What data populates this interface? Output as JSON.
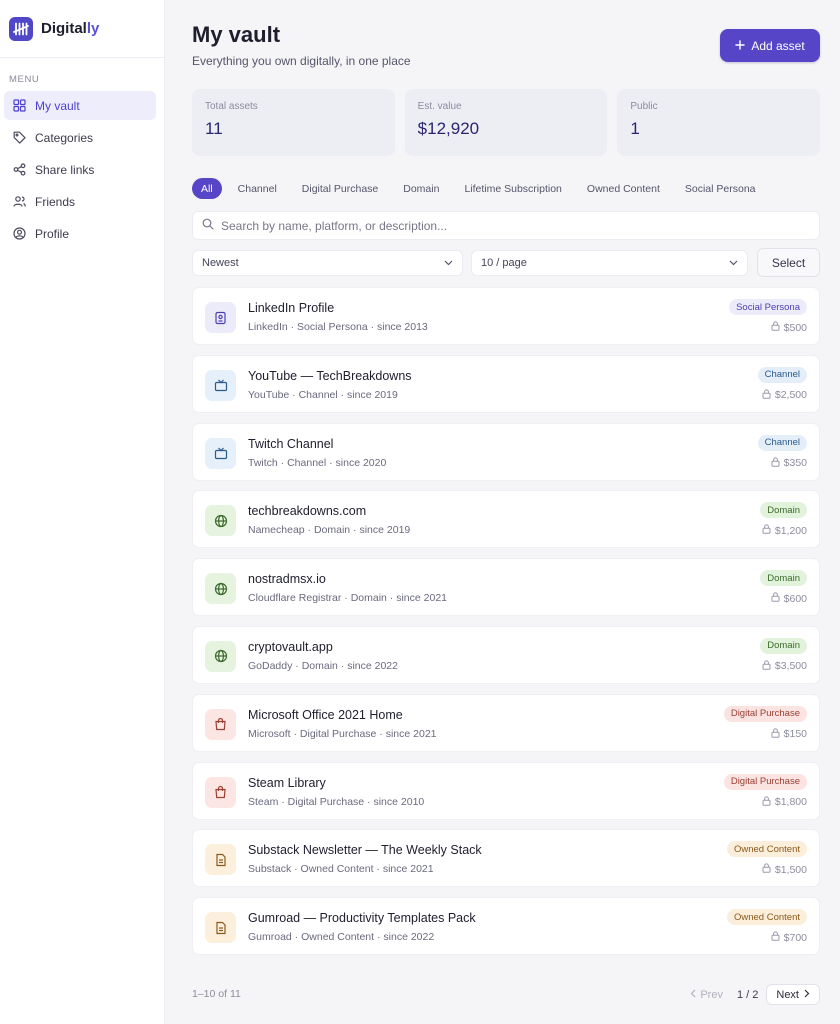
{
  "brand": {
    "name_main": "Digital",
    "name_accent": "ly"
  },
  "sidebar": {
    "menu_label": "MENU",
    "items": [
      {
        "label": "My vault",
        "icon": "grid-icon",
        "active": true
      },
      {
        "label": "Categories",
        "icon": "tag-icon"
      },
      {
        "label": "Share links",
        "icon": "share-icon"
      },
      {
        "label": "Friends",
        "icon": "users-icon"
      },
      {
        "label": "Profile",
        "icon": "user-circle-icon"
      }
    ]
  },
  "header": {
    "title": "My vault",
    "subtitle": "Everything you own digitally, in one place",
    "add_label": "Add asset"
  },
  "stats": [
    {
      "label": "Total assets",
      "value": "11"
    },
    {
      "label": "Est. value",
      "value": "$12,920"
    },
    {
      "label": "Public",
      "value": "1"
    }
  ],
  "filters": [
    "All",
    "Channel",
    "Digital Purchase",
    "Domain",
    "Lifetime Subscription",
    "Owned Content",
    "Social Persona"
  ],
  "search": {
    "placeholder": "Search by name, platform, or description..."
  },
  "controls": {
    "sort": "Newest",
    "per_page": "10 / page",
    "select_label": "Select"
  },
  "category_colors": {
    "Social Persona": {
      "bg": "#ecebfa",
      "fg": "#4b3fb0",
      "icon_bg": "#ecebfa"
    },
    "Channel": {
      "bg": "#e3eef9",
      "fg": "#2a5a8a",
      "icon_bg": "#e6f0fa"
    },
    "Domain": {
      "bg": "#e2f3dc",
      "fg": "#3b6a2c",
      "icon_bg": "#e5f3df"
    },
    "Digital Purchase": {
      "bg": "#fae3e0",
      "fg": "#9a4034",
      "icon_bg": "#fbe6e3"
    },
    "Owned Content": {
      "bg": "#fbeedb",
      "fg": "#8a5a1c",
      "icon_bg": "#fcefdc"
    }
  },
  "assets": [
    {
      "name": "LinkedIn Profile",
      "meta": "LinkedIn · Social Persona · since 2013",
      "category": "Social Persona",
      "price": "$500",
      "icon": "badge-id-icon"
    },
    {
      "name": "YouTube — TechBreakdowns",
      "meta": "YouTube · Channel · since 2019",
      "category": "Channel",
      "price": "$2,500",
      "icon": "tv-icon"
    },
    {
      "name": "Twitch Channel",
      "meta": "Twitch · Channel · since 2020",
      "category": "Channel",
      "price": "$350",
      "icon": "tv-icon"
    },
    {
      "name": "techbreakdowns.com",
      "meta": "Namecheap · Domain · since 2019",
      "category": "Domain",
      "price": "$1,200",
      "icon": "globe-icon"
    },
    {
      "name": "nostradmsx.io",
      "meta": "Cloudflare Registrar · Domain · since 2021",
      "category": "Domain",
      "price": "$600",
      "icon": "globe-icon"
    },
    {
      "name": "cryptovault.app",
      "meta": "GoDaddy · Domain · since 2022",
      "category": "Domain",
      "price": "$3,500",
      "icon": "globe-icon"
    },
    {
      "name": "Microsoft Office 2021 Home",
      "meta": "Microsoft · Digital Purchase · since 2021",
      "category": "Digital Purchase",
      "price": "$150",
      "icon": "shopping-bag-icon"
    },
    {
      "name": "Steam Library",
      "meta": "Steam · Digital Purchase · since 2010",
      "category": "Digital Purchase",
      "price": "$1,800",
      "icon": "shopping-bag-icon"
    },
    {
      "name": "Substack Newsletter — The Weekly Stack",
      "meta": "Substack · Owned Content · since 2021",
      "category": "Owned Content",
      "price": "$1,500",
      "icon": "document-icon"
    },
    {
      "name": "Gumroad — Productivity Templates Pack",
      "meta": "Gumroad · Owned Content · since 2022",
      "category": "Owned Content",
      "price": "$700",
      "icon": "document-icon"
    }
  ],
  "footer": {
    "count": "1–10 of 11",
    "prev": "Prev",
    "page": "1 / 2",
    "next": "Next"
  }
}
